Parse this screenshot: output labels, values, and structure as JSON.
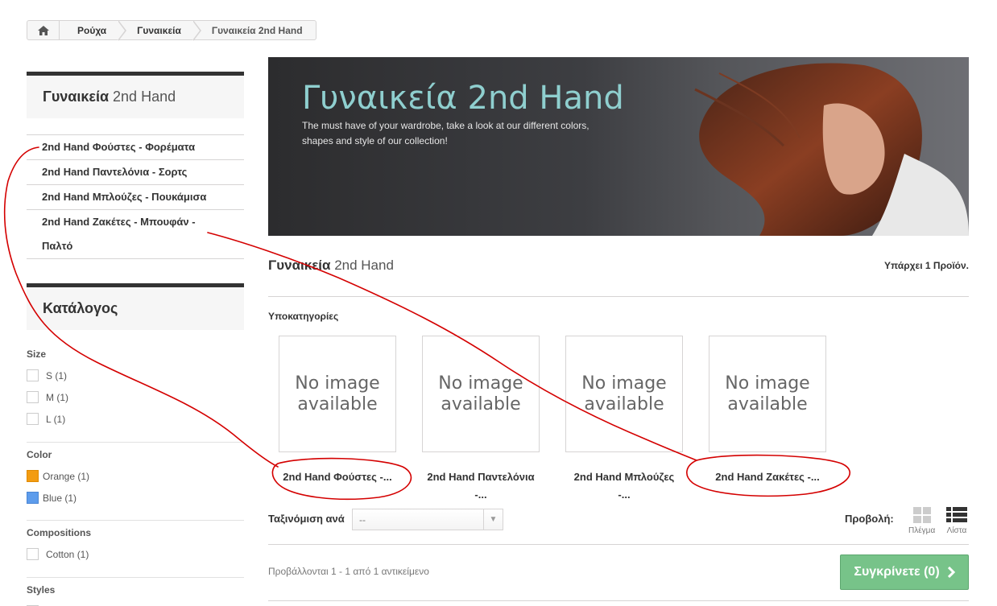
{
  "breadcrumb": {
    "home_icon": "home-icon",
    "items": [
      "Ρούχα",
      "Γυναικεία",
      "Γυναικεία 2nd Hand"
    ]
  },
  "sidebar": {
    "category_title_bold": "Γυναικεία",
    "category_title_rest": " 2nd Hand",
    "subcategories": [
      "2nd Hand Φούστες - Φορέματα",
      "2nd Hand Παντελόνια - Σορτς",
      "2nd Hand Μπλούζες - Πουκάμισα",
      "2nd Hand Ζακέτες - Μπουφάν -",
      "Παλτό"
    ],
    "catalog_title": "Κατάλογος",
    "filters": {
      "size_title": "Size",
      "size_options": [
        "S (1)",
        "M (1)",
        "L (1)"
      ],
      "color_title": "Color",
      "color_options": [
        "Orange (1)",
        "Blue (1)"
      ],
      "color_swatches": [
        "#f39c11",
        "#5d9cec"
      ],
      "compositions_title": "Compositions",
      "compositions_options": [
        "Cotton (1)"
      ],
      "styles_title": "Styles"
    }
  },
  "banner": {
    "title": "Γυναικεία 2nd Hand",
    "description_line1": "The must have of your wardrobe, take a look at our different colors,",
    "description_line2": "shapes and style of our collection!"
  },
  "main": {
    "heading_bold": "Γυναικεία",
    "heading_rest": " 2nd Hand",
    "product_count": "Υπάρχει 1 Προϊόν.",
    "subcategories_heading": "Υποκατηγορίες",
    "no_image_line1": "No image",
    "no_image_line2": "available",
    "subcategory_tiles": [
      {
        "name_line1": "2nd Hand Φούστες -...",
        "name_line2": ""
      },
      {
        "name_line1": "2nd Hand Παντελόνια",
        "name_line2": "-..."
      },
      {
        "name_line1": "2nd Hand Μπλούζες",
        "name_line2": "-..."
      },
      {
        "name_line1": "2nd Hand Ζακέτες -...",
        "name_line2": ""
      }
    ],
    "sort_label": "Ταξινόμιση ανά",
    "sort_value": "--",
    "view_label": "Προβολή:",
    "view_grid_label": "Πλέγμα",
    "view_list_label": "Λίστα",
    "results_text": "Προβάλλονται 1 - 1 από 1 αντικείμενο",
    "compare_label": "Συγκρίνετε (0)"
  },
  "colors": {
    "accent_teal": "#8fcfcf",
    "compare_green": "#77c389",
    "annotation_red": "#d40000"
  }
}
